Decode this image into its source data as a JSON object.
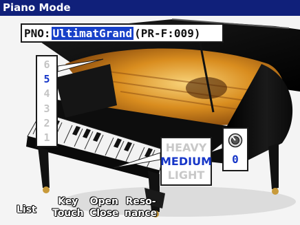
{
  "title": "Piano Mode",
  "program": {
    "prefix": "PNO:",
    "name": "UltimatGrand",
    "code": "(PR-F:009)"
  },
  "key_touch": {
    "levels": [
      "6",
      "5",
      "4",
      "3",
      "2",
      "1"
    ],
    "selected": "5"
  },
  "lid": {
    "options": [
      "HEAVY",
      "MEDIUM",
      "LIGHT"
    ],
    "selected": "MEDIUM"
  },
  "resonance": {
    "icon": "knob-icon",
    "value": "0"
  },
  "function_buttons": [
    {
      "line1": "List",
      "line2": ""
    },
    {
      "line1": "Key",
      "line2": "Touch"
    },
    {
      "line1": "Open",
      "line2": "Close"
    },
    {
      "line1": "Reso-",
      "line2": "nance"
    }
  ],
  "colors": {
    "title_bar": "#10207a",
    "highlight": "#1740c8",
    "active_text": "#1636c8",
    "inactive_text": "#c4c4c4"
  }
}
